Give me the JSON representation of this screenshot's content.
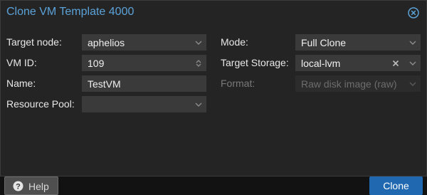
{
  "dialog": {
    "title": "Clone VM Template 4000"
  },
  "left": {
    "target_node": {
      "label": "Target node:",
      "value": "aphelios"
    },
    "vm_id": {
      "label": "VM ID:",
      "value": "109"
    },
    "name": {
      "label": "Name:",
      "value": "TestVM"
    },
    "resource_pool": {
      "label": "Resource Pool:",
      "value": ""
    }
  },
  "right": {
    "mode": {
      "label": "Mode:",
      "value": "Full Clone"
    },
    "target_storage": {
      "label": "Target Storage:",
      "value": "local-lvm"
    },
    "format": {
      "label": "Format:",
      "value": "Raw disk image (raw)"
    }
  },
  "buttons": {
    "help": "Help",
    "clone": "Clone"
  },
  "colors": {
    "accent": "#5ba2d8",
    "primary_button": "#2069b1"
  }
}
